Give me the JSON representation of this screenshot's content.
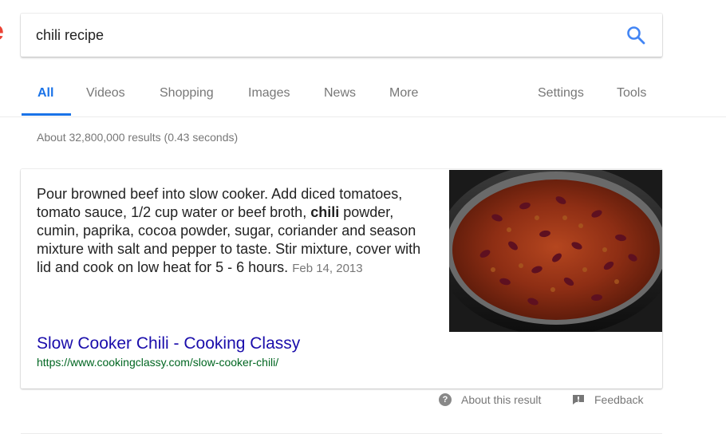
{
  "search": {
    "query": "chili recipe"
  },
  "tabs": [
    "All",
    "Videos",
    "Shopping",
    "Images",
    "News",
    "More"
  ],
  "tools": {
    "settings": "Settings",
    "tools": "Tools"
  },
  "stats": "About 32,800,000 results (0.43 seconds)",
  "featured_snippet": {
    "text_before": "Pour browned beef into slow cooker. Add diced tomatoes, tomato sauce, 1/2 cup water or beef broth, ",
    "bold_term": "chili",
    "text_after": " powder, cumin, paprika, cocoa powder, sugar, coriander and season mixture with salt and pepper to taste. Stir mixture, cover with lid and cook on low heat for 5 - 6 hours.",
    "date": "Feb 14, 2013",
    "title": "Slow Cooker Chili - Cooking Classy",
    "url": "https://www.cookingclassy.com/slow-cooker-chili/",
    "image_name": "chili-in-slow-cooker-photo"
  },
  "footer": {
    "about": "About this result",
    "feedback": "Feedback"
  },
  "colors": {
    "accent_blue": "#1a73e8",
    "link_blue": "#1a0dab",
    "url_green": "#006621",
    "gray_text": "#777777"
  }
}
